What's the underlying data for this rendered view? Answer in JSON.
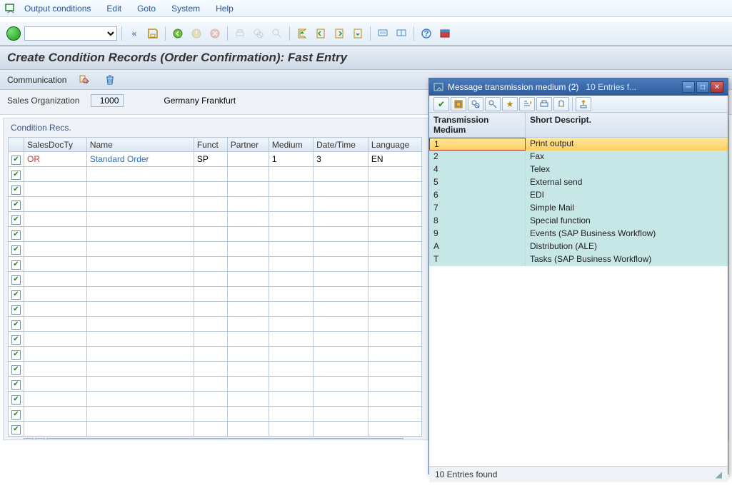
{
  "menu": {
    "items": [
      "Output conditions",
      "Edit",
      "Goto",
      "System",
      "Help"
    ]
  },
  "title": "Create Condition Records (Order Confirmation): Fast Entry",
  "action": {
    "communication": "Communication"
  },
  "header": {
    "sales_org_label": "Sales Organization",
    "sales_org_value": "1000",
    "sales_org_text": "Germany Frankfurt"
  },
  "group_title": "Condition Recs.",
  "columns": [
    "SalesDocTy",
    "Name",
    "Funct",
    "Partner",
    "Medium",
    "Date/Time",
    "Language"
  ],
  "rows": [
    {
      "checked": true,
      "salesdocty": "OR",
      "name": "Standard Order",
      "funct": "SP",
      "partner": "",
      "medium": "1",
      "datetime": "3",
      "language": "EN"
    }
  ],
  "empty_row_count": 18,
  "popup": {
    "title": "Message transmission medium (2)",
    "count_text": "10 Entries f...",
    "columns": [
      "Transmission Medium",
      "Short Descript."
    ],
    "rows": [
      {
        "k": "1",
        "v": "Print output",
        "selected": true
      },
      {
        "k": "2",
        "v": "Fax"
      },
      {
        "k": "4",
        "v": "Telex"
      },
      {
        "k": "5",
        "v": "External send"
      },
      {
        "k": "6",
        "v": "EDI"
      },
      {
        "k": "7",
        "v": "Simple Mail"
      },
      {
        "k": "8",
        "v": "Special function"
      },
      {
        "k": "9",
        "v": "Events (SAP Business Workflow)"
      },
      {
        "k": "A",
        "v": "Distribution (ALE)"
      },
      {
        "k": "T",
        "v": "Tasks (SAP Business Workflow)"
      }
    ],
    "status": "10 Entries found"
  }
}
